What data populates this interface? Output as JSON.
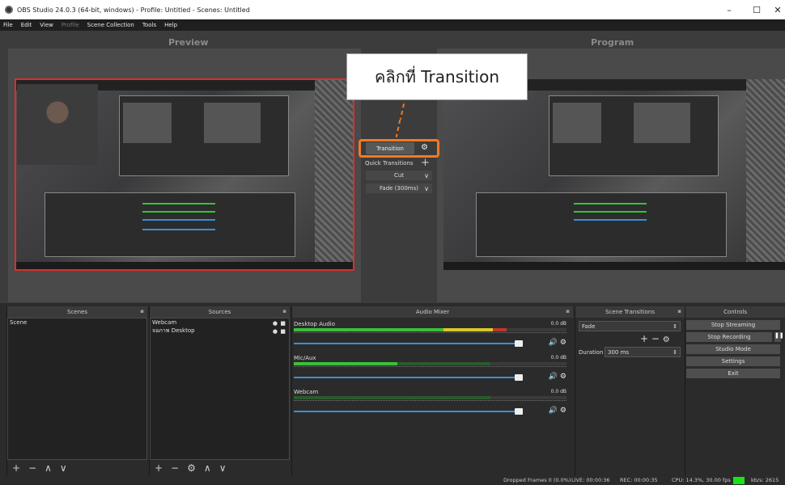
{
  "window": {
    "title": "OBS Studio 24.0.3 (64-bit, windows) - Profile: Untitled - Scenes: Untitled",
    "minimize": "–",
    "maximize": "☐",
    "close": "✕"
  },
  "menu": [
    "File",
    "Edit",
    "View",
    "Profile",
    "Scene Collection",
    "Tools",
    "Help"
  ],
  "preview_label": "Preview",
  "program_label": "Program",
  "callout_text": "คลิกที่ Transition",
  "transition": {
    "button_label": "Transition",
    "quick_transitions_label": "Quick Transitions",
    "cut_label": "Cut",
    "fade_label": "Fade (300ms)"
  },
  "docks": {
    "scenes": {
      "title": "Scenes",
      "items": [
        "Scene"
      ]
    },
    "sources": {
      "title": "Sources",
      "items": [
        "Webcam",
        "จอภาพ Desktop"
      ]
    },
    "audio_mixer": {
      "title": "Audio Mixer",
      "channels": [
        {
          "name": "Desktop Audio",
          "db": "0.0 dB",
          "level": 0.78
        },
        {
          "name": "Mic/Aux",
          "db": "0.0 dB",
          "level": 0.38
        },
        {
          "name": "Webcam",
          "db": "0.0 dB",
          "level": 0.0
        }
      ],
      "ticks": [
        "-60",
        "-55",
        "-50",
        "-45",
        "-40",
        "-35",
        "-30",
        "-25",
        "-20",
        "-15",
        "-10",
        "-5",
        "0"
      ]
    },
    "scene_transitions": {
      "title": "Scene Transitions",
      "selected": "Fade",
      "duration_label": "Duration",
      "duration_value": "300 ms"
    },
    "controls": {
      "title": "Controls",
      "buttons": [
        "Stop Streaming",
        "Stop Recording",
        "Studio Mode",
        "Settings",
        "Exit"
      ]
    }
  },
  "status": {
    "dropped": "Dropped Frames 0 (0.0%)",
    "live": "LIVE: 00:00:36",
    "rec": "REC: 00:00:35",
    "cpu": "CPU: 14.3%, 30.00 fps",
    "kbps": "kb/s: 2615"
  },
  "colors": {
    "highlight": "#f27a21",
    "selection": "#d9302c",
    "meter_green": "#3ac03a",
    "meter_yellow": "#d8c82a",
    "volume_blue": "#3a8fd8",
    "rec_indicator": "#17e317"
  }
}
